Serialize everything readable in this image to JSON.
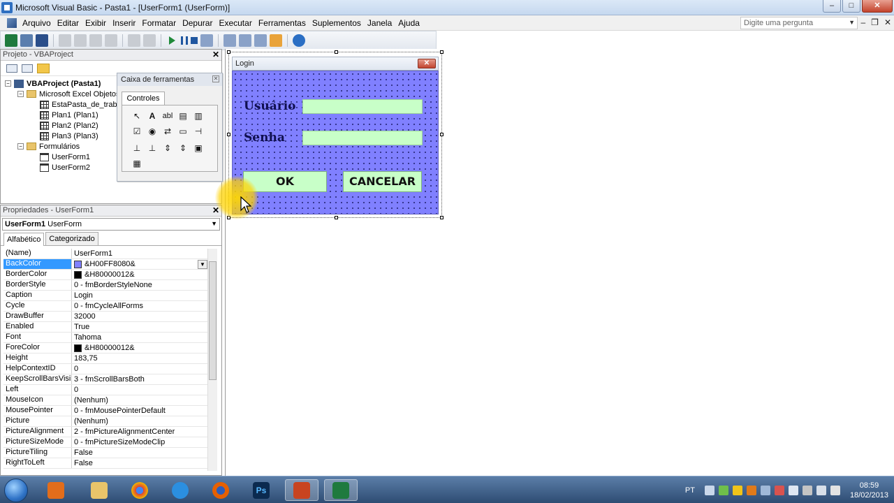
{
  "window": {
    "title": "Microsoft Visual Basic - Pasta1 - [UserForm1 (UserForm)]",
    "min": "–",
    "max": "□",
    "close": "✕"
  },
  "menu": {
    "items": [
      "Arquivo",
      "Editar",
      "Exibir",
      "Inserir",
      "Formatar",
      "Depurar",
      "Executar",
      "Ferramentas",
      "Suplementos",
      "Janela",
      "Ajuda"
    ],
    "help_placeholder": "Digite uma pergunta",
    "mdi_min": "–",
    "mdi_restore": "❐",
    "mdi_close": "✕"
  },
  "project": {
    "title": "Projeto - VBAProject",
    "root": "VBAProject (Pasta1)",
    "excel_folder": "Microsoft Excel Objetos",
    "sheets": [
      "EstaPasta_de_traba",
      "Plan1 (Plan1)",
      "Plan2 (Plan2)",
      "Plan3 (Plan3)"
    ],
    "forms_folder": "Formulários",
    "forms": [
      "UserForm1",
      "UserForm2"
    ]
  },
  "toolbox": {
    "title": "Caixa de ferramentas",
    "tab": "Controles",
    "tools": [
      "↖",
      "A",
      "abl",
      "▤",
      "▥",
      "☑",
      "◉",
      "⇄",
      "▭",
      "⊣",
      "⊥",
      "⊥",
      "⇕",
      "⇕",
      "▣",
      "▦"
    ]
  },
  "properties": {
    "title": "Propriedades - UserForm1",
    "object_name": "UserForm1",
    "object_type": "UserForm",
    "tab_alpha": "Alfabético",
    "tab_cat": "Categorizado",
    "rows": [
      {
        "name": "(Name)",
        "value": "UserForm1"
      },
      {
        "name": "BackColor",
        "value": "&H00FF8080&",
        "swatch": "#8080ff"
      },
      {
        "name": "BorderColor",
        "value": "&H80000012&",
        "swatch": "#000000"
      },
      {
        "name": "BorderStyle",
        "value": "0 - fmBorderStyleNone"
      },
      {
        "name": "Caption",
        "value": "Login"
      },
      {
        "name": "Cycle",
        "value": "0 - fmCycleAllForms"
      },
      {
        "name": "DrawBuffer",
        "value": "32000"
      },
      {
        "name": "Enabled",
        "value": "True"
      },
      {
        "name": "Font",
        "value": "Tahoma"
      },
      {
        "name": "ForeColor",
        "value": "&H80000012&",
        "swatch": "#000000"
      },
      {
        "name": "Height",
        "value": "183,75"
      },
      {
        "name": "HelpContextID",
        "value": "0"
      },
      {
        "name": "KeepScrollBarsVisible",
        "value": "3 - fmScrollBarsBoth"
      },
      {
        "name": "Left",
        "value": "0"
      },
      {
        "name": "MouseIcon",
        "value": "(Nenhum)"
      },
      {
        "name": "MousePointer",
        "value": "0 - fmMousePointerDefault"
      },
      {
        "name": "Picture",
        "value": "(Nenhum)"
      },
      {
        "name": "PictureAlignment",
        "value": "2 - fmPictureAlignmentCenter"
      },
      {
        "name": "PictureSizeMode",
        "value": "0 - fmPictureSizeModeClip"
      },
      {
        "name": "PictureTiling",
        "value": "False"
      },
      {
        "name": "RightToLeft",
        "value": "False"
      }
    ]
  },
  "form": {
    "caption": "Login",
    "close": "✕",
    "label_user": "Usuário",
    "label_pass": "Senha",
    "ok": "OK",
    "cancel": "CANCELAR"
  },
  "taskbar": {
    "lang": "PT",
    "time": "08:59",
    "date": "18/02/2013"
  }
}
